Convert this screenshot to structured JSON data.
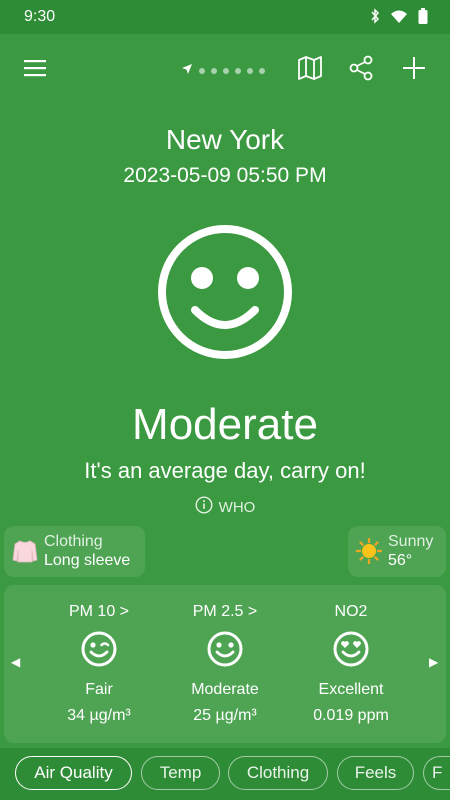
{
  "status": {
    "time": "9:30"
  },
  "location": {
    "city": "New York",
    "datetime": "2023-05-09 05:50 PM",
    "page_count": 7,
    "current_page": 0
  },
  "air_quality": {
    "level": "Moderate",
    "message": "It's an average day, carry on!",
    "source": "WHO"
  },
  "clothing": {
    "label": "Clothing",
    "value": "Long sleeve"
  },
  "weather": {
    "condition": "Sunny",
    "temp": "56°"
  },
  "pollutants": [
    {
      "name": "PM 10 >",
      "face": "winking-face",
      "level": "Fair",
      "value": "34 µg/m³"
    },
    {
      "name": "PM 2.5 >",
      "face": "smiling-face",
      "level": "Moderate",
      "value": "25 µg/m³"
    },
    {
      "name": "NO2",
      "face": "heart-eyes-face",
      "level": "Excellent",
      "value": "0.019 ppm"
    }
  ],
  "tabs": [
    {
      "label": "Air Quality",
      "active": true
    },
    {
      "label": "Temp",
      "active": false
    },
    {
      "label": "Clothing",
      "active": false
    },
    {
      "label": "Feels",
      "active": false
    },
    {
      "label": "F",
      "active": false
    }
  ],
  "colors": {
    "background": "#3b9a41",
    "bars": "#2f8c36",
    "card": "rgba(255,255,255,0.10)"
  }
}
